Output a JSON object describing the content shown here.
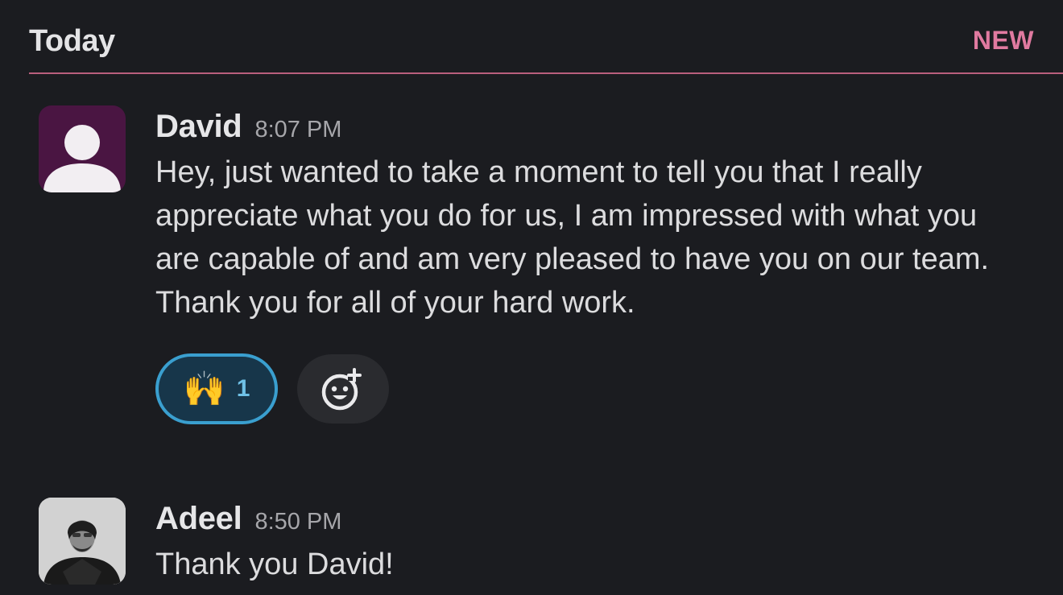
{
  "header": {
    "day": "Today",
    "new_label": "NEW"
  },
  "messages": [
    {
      "author": "David",
      "time": "8:07 PM",
      "text": "Hey, just wanted to take a moment to tell you that I really appreciate what you do for us, I am impressed with what you are capable of and am very pleased to have you on our team. Thank you for all of your hard work.",
      "avatar": "default-user-icon",
      "reactions": [
        {
          "emoji": "🙌",
          "icon": "raised-hands-emoji",
          "count": "1"
        }
      ]
    },
    {
      "author": "Adeel",
      "time": "8:50 PM",
      "text": "Thank you David!",
      "avatar": "user-photo"
    }
  ],
  "colors": {
    "background": "#1b1c20",
    "new_divider": "#b95f7d",
    "new_label": "#e07aa0",
    "reaction_border": "#3a9fcf",
    "avatar_bg": "#4a1542"
  }
}
